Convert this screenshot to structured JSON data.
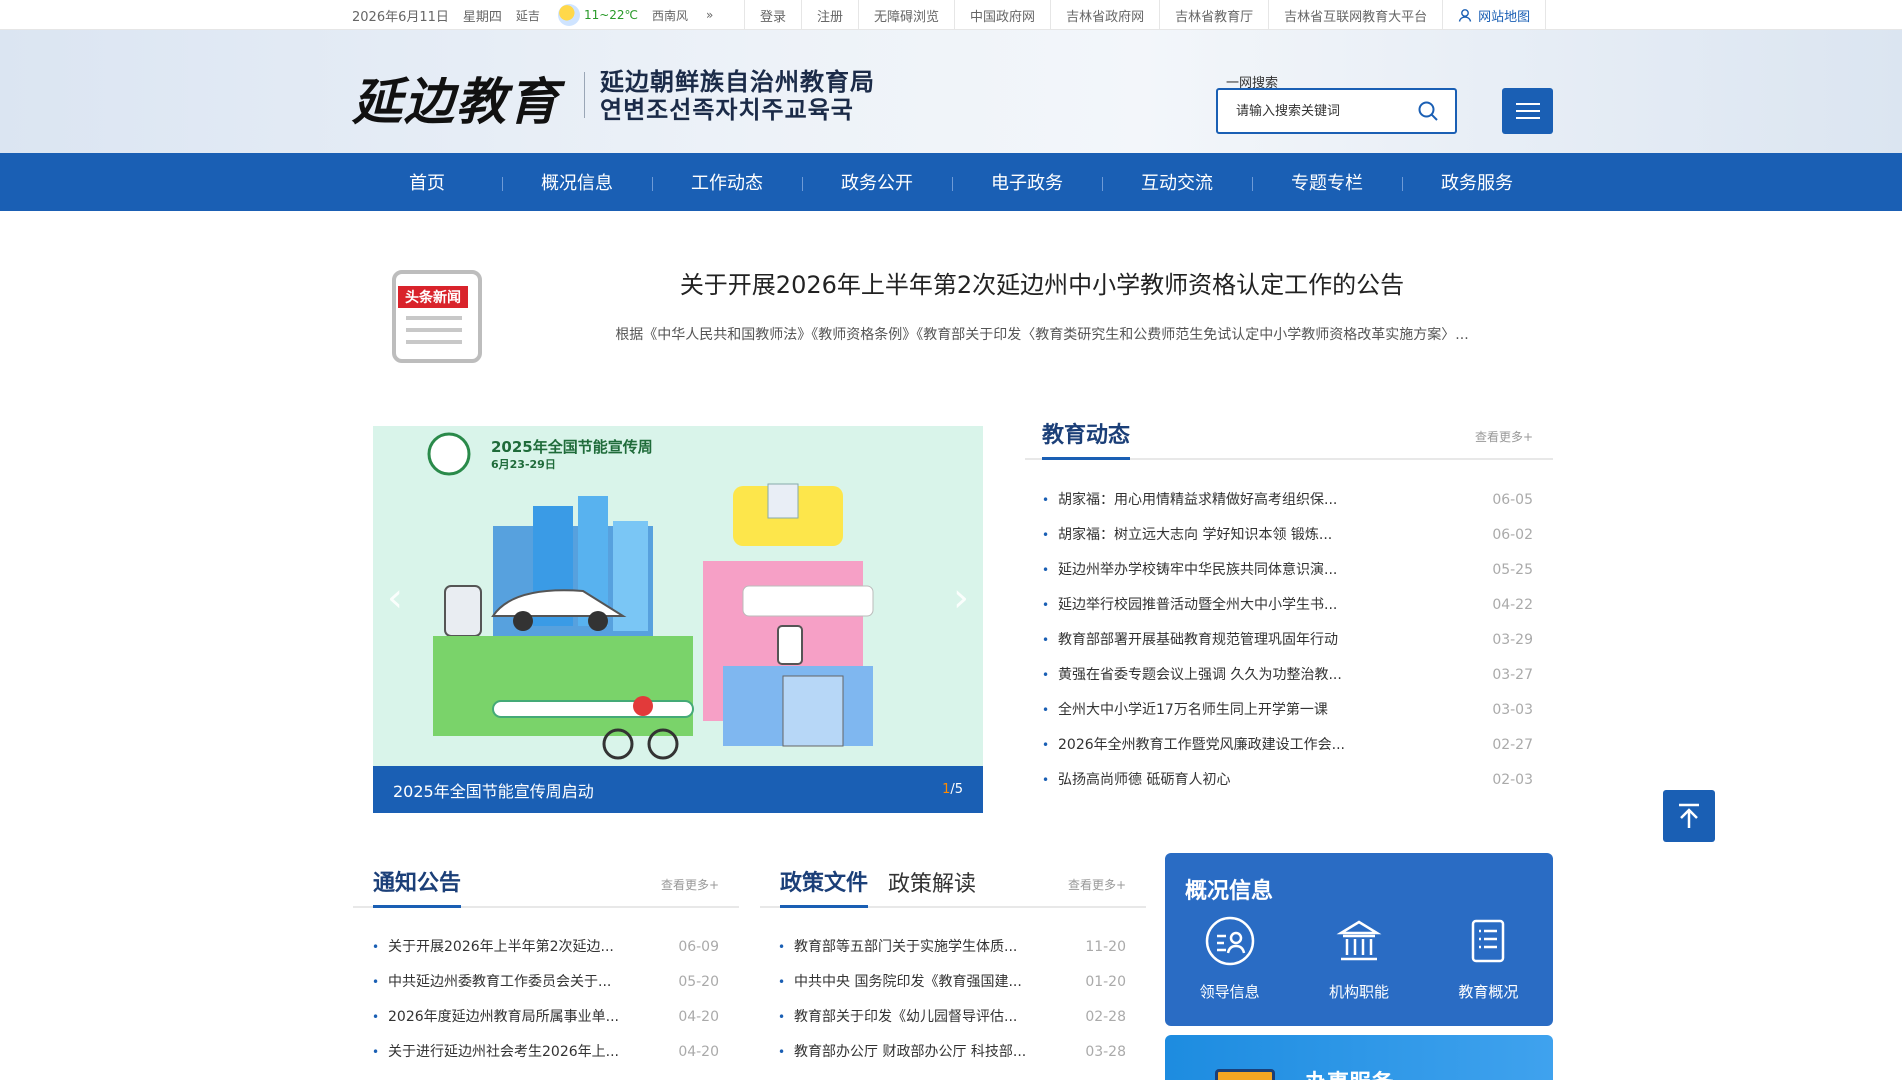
{
  "topbar": {
    "date": "2026年6月11日",
    "weekday": "星期四",
    "city": "延吉",
    "temp": "11~22℃",
    "wind": "西南风",
    "links": [
      "登录",
      "注册",
      "无障碍浏览",
      "中国政府网",
      "吉林省政府网",
      "吉林省教育厅",
      "吉林省互联网教育大平台"
    ],
    "sitemap": "网站地图"
  },
  "header": {
    "logo_text_a": "延边",
    "logo_text_b": "教育",
    "org_cn": "延边朝鲜族自治州教育局",
    "org_kr": "연변조선족자치주교육국",
    "search_label": "一网搜索",
    "search_placeholder": "请输入搜索关键词"
  },
  "nav": [
    "首页",
    "概况信息",
    "工作动态",
    "政务公开",
    "电子政务",
    "互动交流",
    "专题专栏",
    "政务服务"
  ],
  "headline": {
    "badge": "头条新闻",
    "title": "关于开展2026年上半年第2次延边州中小学教师资格认定工作的公告",
    "summary": "根据《中华人民共和国教师法》《教师资格条例》《教育部关于印发〈教育类研究生和公费师范生免试认定中小学教师资格改革实施方案〉..."
  },
  "carousel": {
    "poster_title": "2025年全国节能宣传周",
    "poster_date": "6月23-29日",
    "caption": "2025年全国节能宣传周启动",
    "current": "1",
    "total": "/5"
  },
  "edu_news": {
    "title": "教育动态",
    "more": "查看更多+",
    "items": [
      {
        "t": "胡家福：用心用情精益求精做好高考组织保...",
        "d": "06-05"
      },
      {
        "t": "胡家福：树立远大志向 学好知识本领 锻炼...",
        "d": "06-02"
      },
      {
        "t": "延边州举办学校铸牢中华民族共同体意识演...",
        "d": "05-25"
      },
      {
        "t": "延边举行校园推普活动暨全州大中小学生书...",
        "d": "04-22"
      },
      {
        "t": "教育部部署开展基础教育规范管理巩固年行动",
        "d": "03-29"
      },
      {
        "t": "黄强在省委专题会议上强调 久久为功整治教...",
        "d": "03-27"
      },
      {
        "t": "全州大中小学近17万名师生同上开学第一课",
        "d": "03-03"
      },
      {
        "t": "2026年全州教育工作暨党风廉政建设工作会...",
        "d": "02-27"
      },
      {
        "t": "弘扬高尚师德 砥砺育人初心",
        "d": "02-03"
      }
    ]
  },
  "notices": {
    "title": "通知公告",
    "more": "查看更多+",
    "items": [
      {
        "t": "关于开展2026年上半年第2次延边...",
        "d": "06-09"
      },
      {
        "t": "中共延边州委教育工作委员会关于...",
        "d": "05-20"
      },
      {
        "t": "2026年度延边州教育局所属事业单...",
        "d": "04-20"
      },
      {
        "t": "关于进行延边州社会考生2026年上...",
        "d": "04-20"
      }
    ]
  },
  "policy": {
    "tab_active": "政策文件",
    "tab_other": "政策解读",
    "more": "查看更多+",
    "items": [
      {
        "t": "教育部等五部门关于实施学生体质...",
        "d": "11-20"
      },
      {
        "t": "中共中央 国务院印发《教育强国建...",
        "d": "01-20"
      },
      {
        "t": "教育部关于印发《幼儿园督导评估...",
        "d": "02-28"
      },
      {
        "t": "教育部办公厅 财政部办公厅 科技部...",
        "d": "03-28"
      }
    ]
  },
  "info_panel": {
    "title": "概况信息",
    "items": [
      "领导信息",
      "机构职能",
      "教育概况"
    ]
  },
  "service_panel": {
    "title": "办事服务"
  },
  "colors": {
    "primary": "#1a5fb4",
    "nav_bg": "#1a5fb4",
    "panel_bg": "#2a6cc4",
    "date_gray": "#aaaaaa"
  }
}
